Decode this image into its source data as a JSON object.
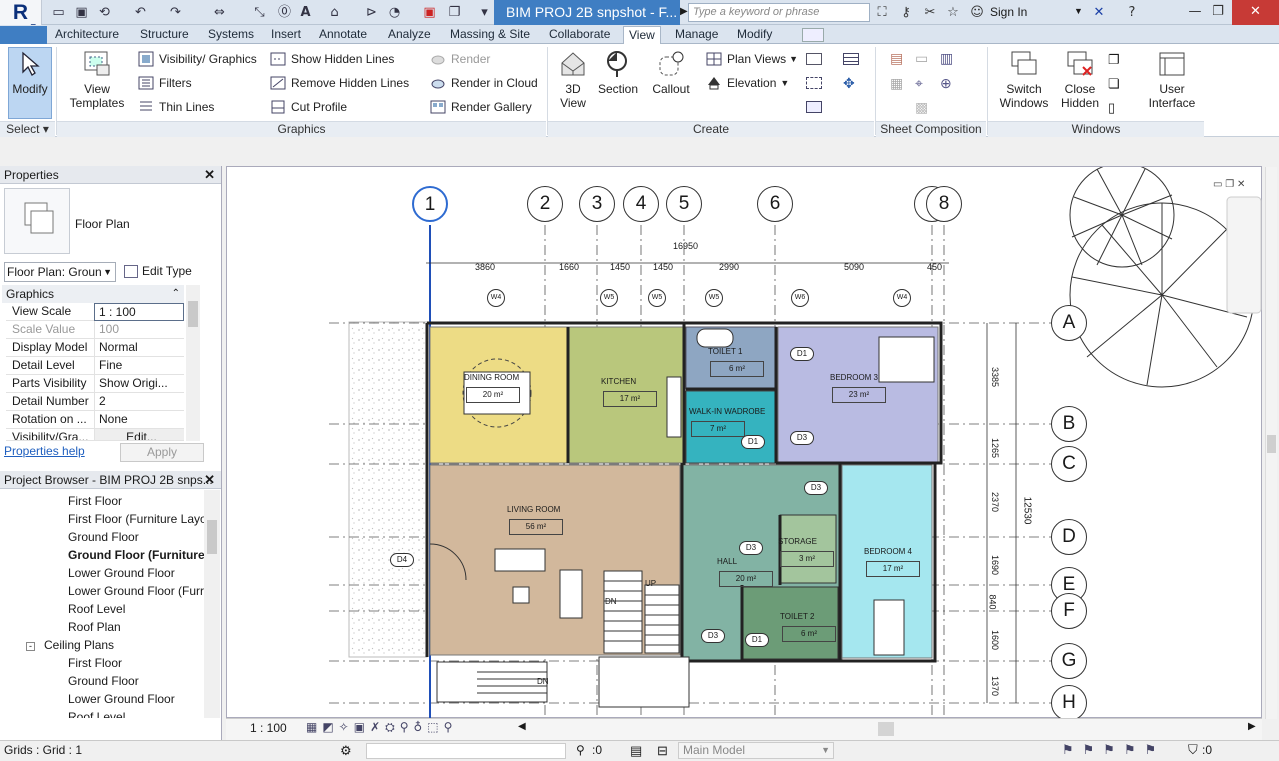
{
  "titlebar": {
    "document_title": "BIM PROJ 2B snpshot - F...",
    "search_placeholder": "Type a keyword or phrase",
    "signin": "Sign In"
  },
  "tabs": [
    "Architecture",
    "Structure",
    "Systems",
    "Insert",
    "Annotate",
    "Analyze",
    "Massing & Site",
    "Collaborate",
    "View",
    "Manage",
    "Modify"
  ],
  "active_tab": "View",
  "ribbon": {
    "select": {
      "modify_label": "Modify",
      "panel": "Select ▾"
    },
    "graphics": {
      "panel": "Graphics",
      "view_templates": "View\nTemplates",
      "visibility": "Visibility/ Graphics",
      "filters": "Filters",
      "thin_lines": "Thin  Lines",
      "show_hidden": "Show  Hidden Lines",
      "remove_hidden": "Remove  Hidden Lines",
      "cut_profile": "Cut  Profile",
      "render": "Render",
      "render_cloud": "Render  in Cloud",
      "render_gallery": "Render  Gallery"
    },
    "create": {
      "panel": "Create",
      "view3d": "3D\nView",
      "section": "Section",
      "callout": "Callout",
      "plan_views": "Plan  Views",
      "elevation": "Elevation"
    },
    "sheet": {
      "panel": "Sheet Composition"
    },
    "windows": {
      "panel": "Windows",
      "switch": "Switch\nWindows",
      "close_hidden": "Close\nHidden",
      "user_interface": "User\nInterface"
    }
  },
  "properties": {
    "title": "Properties",
    "type_name": "Floor Plan",
    "selector": "Floor Plan: Groun",
    "edit_type": "Edit Type",
    "category": "Graphics",
    "rows": [
      {
        "name": "View Scale",
        "value": "1 : 100"
      },
      {
        "name": "Scale Value",
        "value": "100"
      },
      {
        "name": "Display Model",
        "value": "Normal"
      },
      {
        "name": "Detail Level",
        "value": "Fine"
      },
      {
        "name": "Parts Visibility",
        "value": "Show Origi..."
      },
      {
        "name": "Detail Number",
        "value": "2"
      },
      {
        "name": "Rotation on ...",
        "value": "None"
      },
      {
        "name": "Visibility/Gra...",
        "value": "Edit..."
      }
    ],
    "help": "Properties help",
    "apply": "Apply"
  },
  "browser": {
    "title": "Project Browser - BIM PROJ 2B snps...",
    "items": [
      "First Floor",
      "First Floor (Furniture Layo",
      "Ground  Floor",
      "Ground  Floor  (Furniture",
      "Lower Ground Floor",
      "Lower Ground Floor (Furr",
      "Roof Level",
      "Roof Plan",
      "Ceiling Plans",
      "First Floor",
      "Ground  Floor",
      "Lower Ground Floor",
      "Roof Level"
    ]
  },
  "drawing": {
    "grids_v": [
      "1",
      "2",
      "3",
      "4",
      "5",
      "6",
      "7",
      "8"
    ],
    "grids_h": [
      "A",
      "B",
      "C",
      "D",
      "E",
      "F",
      "G",
      "H"
    ],
    "total_dim": "16950",
    "dims_top": [
      "3860",
      "1660",
      "1450",
      "1450",
      "2990",
      "5090",
      "450"
    ],
    "dims_right": [
      "3385",
      "1265",
      "2370",
      "1690",
      "840",
      "1600",
      "1370"
    ],
    "overall_right": "12530",
    "windows": [
      "W4",
      "W5",
      "W5",
      "W5",
      "W6",
      "W4"
    ],
    "rooms": [
      {
        "name": "DINING ROOM",
        "area": "20 m²"
      },
      {
        "name": "KITCHEN",
        "area": "17 m²"
      },
      {
        "name": "TOILET 1",
        "area": "6 m²"
      },
      {
        "name": "BEDROOM 3",
        "area": "23 m²"
      },
      {
        "name": "WALK-IN WADROBE",
        "area": "7 m²"
      },
      {
        "name": "LIVING ROOM",
        "area": "56 m²"
      },
      {
        "name": "HALL",
        "area": "20 m²"
      },
      {
        "name": "STORAGE",
        "area": "3 m²"
      },
      {
        "name": "TOILET 2",
        "area": "6 m²"
      },
      {
        "name": "BEDROOM 4",
        "area": "17 m²"
      }
    ],
    "doors": [
      "D1",
      "D1",
      "D3",
      "D3",
      "D3",
      "D3",
      "D4",
      "D1"
    ],
    "stair_labels": [
      "UP",
      "DN",
      "DN"
    ]
  },
  "viewbar": {
    "scale": "1 : 100"
  },
  "status": {
    "text": "Grids : Grid : 1",
    "count1": ":0",
    "model": "Main Model",
    "filter": ":0"
  }
}
